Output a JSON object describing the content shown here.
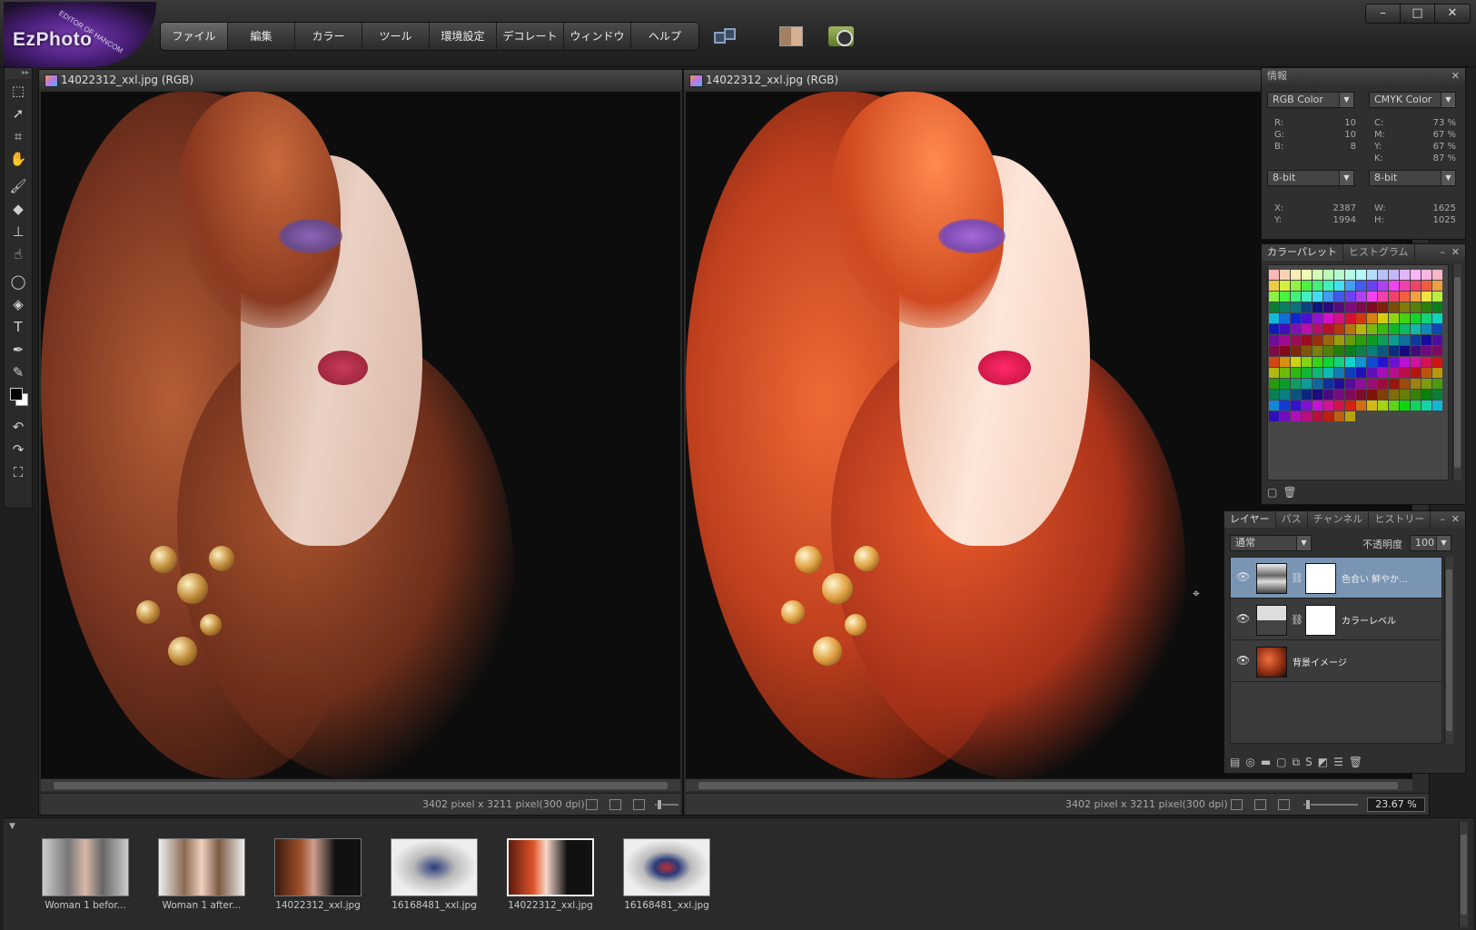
{
  "app": {
    "logo_text": "EzPhoto",
    "logo_subtext": "EDITOR OF HANCOM"
  },
  "menu": [
    "ファイル",
    "編集",
    "カラー",
    "ツール",
    "環境設定",
    "デコレート",
    "ウィンドウ",
    "ヘルプ"
  ],
  "window_controls": [
    "–",
    "□",
    "✕"
  ],
  "documents": [
    {
      "title": "14022312_xxl.jpg (RGB)",
      "status": "3402 pixel x 3211 pixel(300 dpi)",
      "hair_color": "#9a4a2a"
    },
    {
      "title": "14022312_xxl.jpg (RGB)",
      "status": "3402 pixel x 3211 pixel(300 dpi)",
      "zoom": "23.67 %",
      "hair_color": "#e0552a"
    }
  ],
  "info_panel": {
    "title": "情報",
    "mode_left": "RGB Color",
    "mode_right": "CMYK Color",
    "rgb": [
      {
        "k": "R:",
        "v": "10"
      },
      {
        "k": "G:",
        "v": "10"
      },
      {
        "k": "B:",
        "v": "8"
      }
    ],
    "cmyk": [
      {
        "k": "C:",
        "v": "73 %"
      },
      {
        "k": "M:",
        "v": "67 %"
      },
      {
        "k": "Y:",
        "v": "67 %"
      },
      {
        "k": "K:",
        "v": "87 %"
      }
    ],
    "bit_left": "8-bit",
    "bit_right": "8-bit",
    "pos": [
      {
        "k": "X:",
        "v": "2387"
      },
      {
        "k": "Y:",
        "v": "1994"
      }
    ],
    "size": [
      {
        "k": "W:",
        "v": "1625"
      },
      {
        "k": "H:",
        "v": "1025"
      }
    ]
  },
  "palette_panel": {
    "tabs": [
      "カラーパレット",
      "ヒストグラム"
    ]
  },
  "layers_panel": {
    "tabs": [
      "レイヤー",
      "パス",
      "チャンネル",
      "ヒストリー"
    ],
    "blend_mode": "通常",
    "opacity_label": "不透明度",
    "opacity_value": "100",
    "layers": [
      {
        "name": "色合い 鮮やか...",
        "selected": true
      },
      {
        "name": "カラーレベル",
        "selected": false
      },
      {
        "name": "背景イメージ",
        "selected": false
      }
    ]
  },
  "filmstrip": [
    {
      "label": "Woman 1 befor...",
      "selected": false
    },
    {
      "label": "Woman 1 after...",
      "selected": false
    },
    {
      "label": "14022312_xxl.jpg",
      "selected": false
    },
    {
      "label": "16168481_xxl.jpg",
      "selected": false
    },
    {
      "label": "14022312_xxl.jpg",
      "selected": true
    },
    {
      "label": "16168481_xxl.jpg",
      "selected": false
    }
  ]
}
